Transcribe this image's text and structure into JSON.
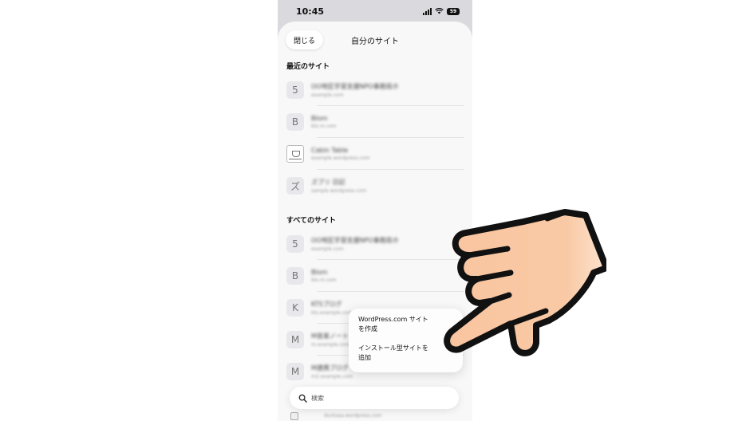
{
  "status_bar": {
    "time": "10:45",
    "battery": "59"
  },
  "header": {
    "close_label": "閉じる",
    "title": "自分のサイト"
  },
  "recent_sites": {
    "title": "最近のサイト",
    "items": [
      {
        "initial": "5",
        "name": "OO地区学習支援NPO事務局ホ",
        "url": "example.com"
      },
      {
        "initial": "B",
        "name": "Blom",
        "url": "blo.m.com"
      },
      {
        "initial": "",
        "icon": "cup-image-icon",
        "name": "Cabin Table",
        "url": "example.wordpress.com"
      },
      {
        "initial": "ズ",
        "name": "ズブリ 日記",
        "url": "sample.wordpress.com"
      }
    ]
  },
  "all_sites": {
    "title": "すべてのサイト",
    "items": [
      {
        "initial": "5",
        "name": "OO地区学習支援NPO事務局ホ",
        "url": "example.com"
      },
      {
        "initial": "B",
        "name": "Blom",
        "url": "blo.m.com"
      },
      {
        "initial": "K",
        "name": "KTSブログ",
        "url": "kts.example.com"
      },
      {
        "initial": "M",
        "name": "M音楽ノート",
        "url": "m.example.com"
      },
      {
        "initial": "M",
        "name": "M連携ブログ",
        "url": "m2.example.com"
      }
    ]
  },
  "bottom_peek_url": "ducksaa.wordpress.com",
  "popup_menu": {
    "items": [
      {
        "line1": "WordPress.com サイト",
        "line2": "を作成"
      },
      {
        "line1": "インストール型サイトを",
        "line2": "追加"
      }
    ]
  },
  "search": {
    "placeholder": "検索"
  },
  "colors": {
    "sheet_bg": "#f8f8f8",
    "hand_fill": "#f9c9a5",
    "hand_outline": "#111111"
  }
}
